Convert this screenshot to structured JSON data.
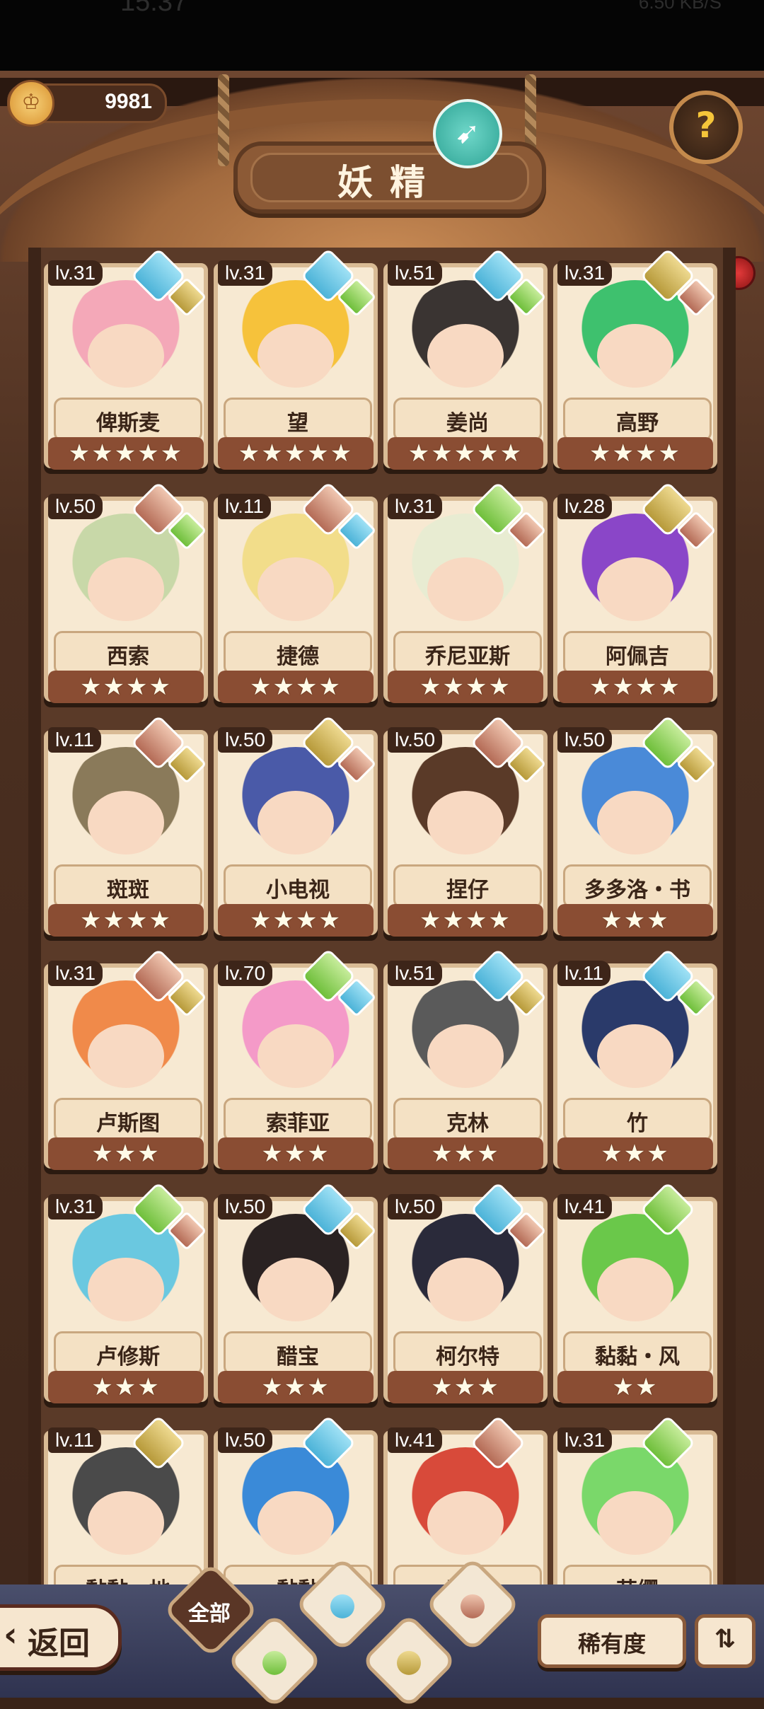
{
  "status": {
    "time": "15:37",
    "net": "6.50 KB/S"
  },
  "header": {
    "coins": "9981",
    "title": "妖精",
    "help_icon": "question-sprout-icon",
    "rocket_icon": "rocket-icon"
  },
  "colors": {
    "water": "#4cb3d8",
    "leaf": "#6fbf3b",
    "earth": "#b79a3a",
    "rock": "#b46b56"
  },
  "cards": [
    {
      "level": "lv.31",
      "name": "俾斯麦",
      "stars": "★★★★★",
      "gem1": "water",
      "gem2": "earth",
      "hair": "#f4a8b8"
    },
    {
      "level": "lv.31",
      "name": "望",
      "stars": "★★★★★",
      "gem1": "water",
      "gem2": "leaf",
      "hair": "#f6c23b"
    },
    {
      "level": "lv.51",
      "name": "姜尚",
      "stars": "★★★★★",
      "gem1": "water",
      "gem2": "leaf",
      "hair": "#3a3432"
    },
    {
      "level": "lv.31",
      "name": "高野",
      "stars": "★★★★",
      "gem1": "earth",
      "gem2": "rock",
      "hair": "#3ec16e"
    },
    {
      "level": "lv.50",
      "name": "西索",
      "stars": "★★★★",
      "gem1": "rock",
      "gem2": "leaf",
      "hair": "#c8d8a8"
    },
    {
      "level": "lv.11",
      "name": "捷德",
      "stars": "★★★★",
      "gem1": "rock",
      "gem2": "water",
      "hair": "#f2dd8a"
    },
    {
      "level": "lv.31",
      "name": "乔尼亚斯",
      "stars": "★★★★",
      "gem1": "leaf",
      "gem2": "rock",
      "hair": "#e8ecd2"
    },
    {
      "level": "lv.28",
      "name": "阿佩吉",
      "stars": "★★★★",
      "gem1": "earth",
      "gem2": "rock",
      "hair": "#8a46c8"
    },
    {
      "level": "lv.11",
      "name": "斑斑",
      "stars": "★★★★",
      "gem1": "rock",
      "gem2": "earth",
      "hair": "#8a7a5a"
    },
    {
      "level": "lv.50",
      "name": "小电视",
      "stars": "★★★★",
      "gem1": "earth",
      "gem2": "rock",
      "hair": "#4a5aa8"
    },
    {
      "level": "lv.50",
      "name": "捏仔",
      "stars": "★★★★",
      "gem1": "rock",
      "gem2": "earth",
      "hair": "#5a3a28"
    },
    {
      "level": "lv.50",
      "name": "多多洛・书",
      "stars": "★★★",
      "gem1": "leaf",
      "gem2": "earth",
      "hair": "#4a8ad8"
    },
    {
      "level": "lv.31",
      "name": "卢斯图",
      "stars": "★★★",
      "gem1": "rock",
      "gem2": "earth",
      "hair": "#f08a4a"
    },
    {
      "level": "lv.70",
      "name": "索菲亚",
      "stars": "★★★",
      "gem1": "leaf",
      "gem2": "water",
      "hair": "#f49ac8"
    },
    {
      "level": "lv.51",
      "name": "克林",
      "stars": "★★★",
      "gem1": "water",
      "gem2": "earth",
      "hair": "#5a5a5a"
    },
    {
      "level": "lv.11",
      "name": "竹",
      "stars": "★★★",
      "gem1": "water",
      "gem2": "leaf",
      "hair": "#2a3a6a"
    },
    {
      "level": "lv.31",
      "name": "卢修斯",
      "stars": "★★★",
      "gem1": "leaf",
      "gem2": "rock",
      "hair": "#6ac8e0"
    },
    {
      "level": "lv.50",
      "name": "醋宝",
      "stars": "★★★",
      "gem1": "water",
      "gem2": "earth",
      "hair": "#2a2222"
    },
    {
      "level": "lv.50",
      "name": "柯尔特",
      "stars": "★★★",
      "gem1": "water",
      "gem2": "rock",
      "hair": "#2a2a3a"
    },
    {
      "level": "lv.41",
      "name": "黏黏・风",
      "stars": "★★",
      "gem1": "leaf",
      "gem2": "",
      "hair": "#6ac84a"
    },
    {
      "level": "lv.11",
      "name": "黏黏・地",
      "stars": "",
      "gem1": "earth",
      "gem2": "",
      "hair": "#4a4a4a"
    },
    {
      "level": "lv.50",
      "name": "黏黏",
      "stars": "",
      "gem1": "water",
      "gem2": "",
      "hair": "#3a8ad8"
    },
    {
      "level": "lv.41",
      "name": "黏黏",
      "stars": "",
      "gem1": "rock",
      "gem2": "",
      "hair": "#d84a3a"
    },
    {
      "level": "lv.31",
      "name": "苏缨",
      "stars": "",
      "gem1": "leaf",
      "gem2": "",
      "hair": "#7ad86a"
    }
  ],
  "footer": {
    "back": "返回",
    "tabs": [
      {
        "label": "全部",
        "icon": "all-icon"
      },
      {
        "label": "",
        "icon": "leaf-sprout-icon"
      },
      {
        "label": "",
        "icon": "water-drop-icon"
      },
      {
        "label": "",
        "icon": "earth-mountain-icon"
      },
      {
        "label": "",
        "icon": "rock-peak-icon"
      }
    ],
    "sort_label": "稀有度",
    "order_icon": "sort-order-icon"
  }
}
